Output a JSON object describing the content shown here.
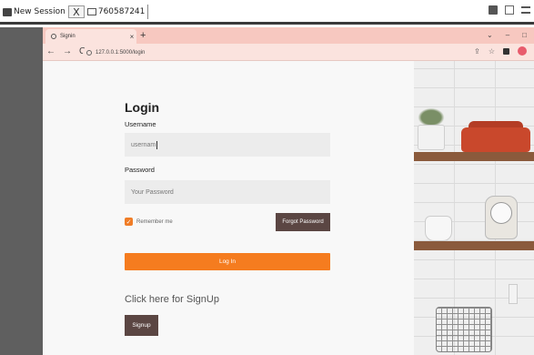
{
  "session": {
    "label": "New Session",
    "close_glyph": "X",
    "session_id": "760587241"
  },
  "browser": {
    "tab_title": "Signin",
    "tab_close": "×",
    "new_tab": "+",
    "url": "127.0.0.1:5000/login",
    "win_min": "–",
    "win_max": "□",
    "win_chevron": "⌄"
  },
  "form": {
    "title": "Login",
    "username_label": "Username",
    "username_value": "usernam",
    "password_label": "Password",
    "password_placeholder": "Your Password",
    "remember_label": "Remember me",
    "remember_checked": true,
    "forgot_label": "Forgot Password",
    "login_label": "Log In",
    "signup_prompt": "Click here for SignUp",
    "signup_label": "Signup"
  },
  "colors": {
    "accent": "#f57c1f",
    "dark_button": "#5b4643",
    "tabstrip": "#f7c8c0"
  },
  "icons": {
    "nav": [
      "back-icon",
      "forward-icon",
      "reload-icon"
    ],
    "toolbar": [
      "share-icon",
      "star-icon",
      "sidebar-icon",
      "profile-icon"
    ]
  }
}
